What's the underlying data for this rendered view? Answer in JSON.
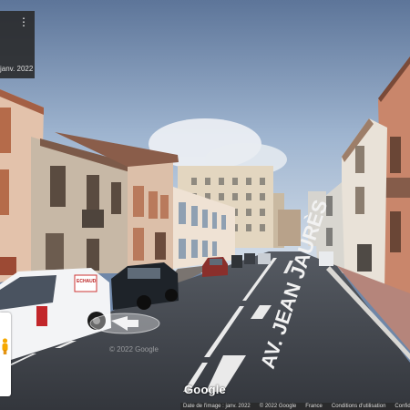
{
  "date_card": {
    "date": "janv. 2022",
    "menu_icon": "more-vert-icon"
  },
  "road_marking": {
    "text": "AV. JEAN JAURÈS"
  },
  "van_logo": "ECHAUD",
  "watermark": "© 2022 Google",
  "logo": "Google",
  "footer": {
    "date_text": "Date de l'image : janv. 2022",
    "copyright": "© 2022 Google",
    "country": "France",
    "terms": "Conditions d'utilisation",
    "privacy": "Confidentialité"
  },
  "colors": {
    "sky": "#6f87a8",
    "road": "#3a3e45",
    "building_left": "#d9b9a4",
    "building_right": "#c7866b"
  }
}
